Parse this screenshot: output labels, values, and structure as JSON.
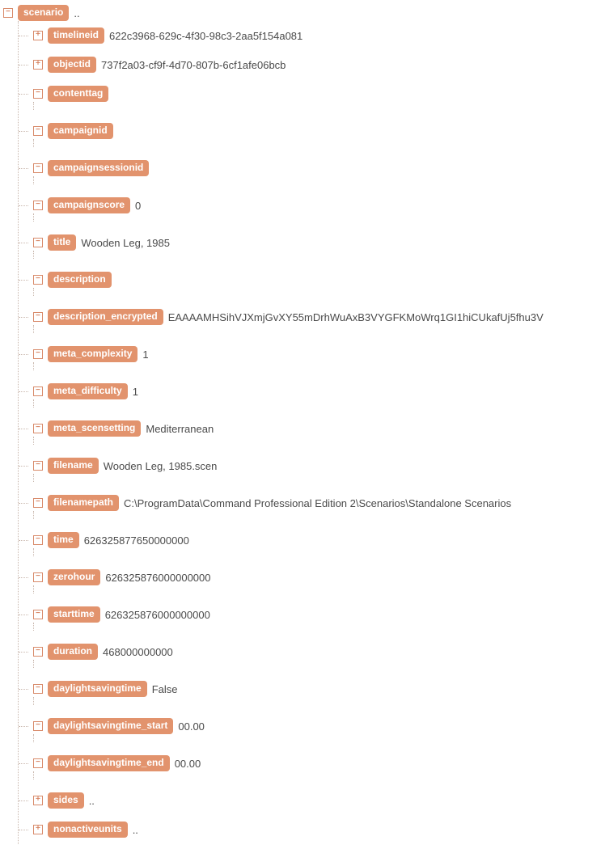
{
  "root": {
    "tag": "scenario",
    "value": "..",
    "state": "minus",
    "children": [
      {
        "tag": "timelineid",
        "value": "622c3968-629c-4f30-98c3-2aa5f154a081",
        "state": "plus",
        "hasSub": false
      },
      {
        "tag": "objectid",
        "value": "737f2a03-cf9f-4d70-807b-6cf1afe06bcb",
        "state": "plus",
        "hasSub": false
      },
      {
        "tag": "contenttag",
        "value": "",
        "state": "minus",
        "hasSub": true
      },
      {
        "tag": "campaignid",
        "value": "",
        "state": "minus",
        "hasSub": true
      },
      {
        "tag": "campaignsessionid",
        "value": "",
        "state": "minus",
        "hasSub": true
      },
      {
        "tag": "campaignscore",
        "value": "0",
        "state": "minus",
        "hasSub": true
      },
      {
        "tag": "title",
        "value": "Wooden Leg, 1985",
        "state": "minus",
        "hasSub": true
      },
      {
        "tag": "description",
        "value": "",
        "state": "minus",
        "hasSub": true
      },
      {
        "tag": "description_encrypted",
        "value": "EAAAAMHSihVJXmjGvXY55mDrhWuAxB3VYGFKMoWrq1GI1hiCUkafUj5fhu3V",
        "state": "minus",
        "hasSub": true
      },
      {
        "tag": "meta_complexity",
        "value": "1",
        "state": "minus",
        "hasSub": true
      },
      {
        "tag": "meta_difficulty",
        "value": "1",
        "state": "minus",
        "hasSub": true
      },
      {
        "tag": "meta_scensetting",
        "value": "Mediterranean",
        "state": "minus",
        "hasSub": true
      },
      {
        "tag": "filename",
        "value": "Wooden Leg, 1985.scen",
        "state": "minus",
        "hasSub": true
      },
      {
        "tag": "filenamepath",
        "value": "C:\\ProgramData\\Command Professional Edition 2\\Scenarios\\Standalone Scenarios",
        "state": "minus",
        "hasSub": true
      },
      {
        "tag": "time",
        "value": "626325877650000000",
        "state": "minus",
        "hasSub": true
      },
      {
        "tag": "zerohour",
        "value": "626325876000000000",
        "state": "minus",
        "hasSub": true
      },
      {
        "tag": "starttime",
        "value": "626325876000000000",
        "state": "minus",
        "hasSub": true
      },
      {
        "tag": "duration",
        "value": "468000000000",
        "state": "minus",
        "hasSub": true
      },
      {
        "tag": "daylightsavingtime",
        "value": "False",
        "state": "minus",
        "hasSub": true
      },
      {
        "tag": "daylightsavingtime_start",
        "value": "00.00",
        "state": "minus",
        "hasSub": true
      },
      {
        "tag": "daylightsavingtime_end",
        "value": "00.00",
        "state": "minus",
        "hasSub": true
      },
      {
        "tag": "sides",
        "value": "..",
        "state": "plus",
        "hasSub": false
      },
      {
        "tag": "nonactiveunits",
        "value": "..",
        "state": "plus",
        "hasSub": false
      }
    ]
  }
}
